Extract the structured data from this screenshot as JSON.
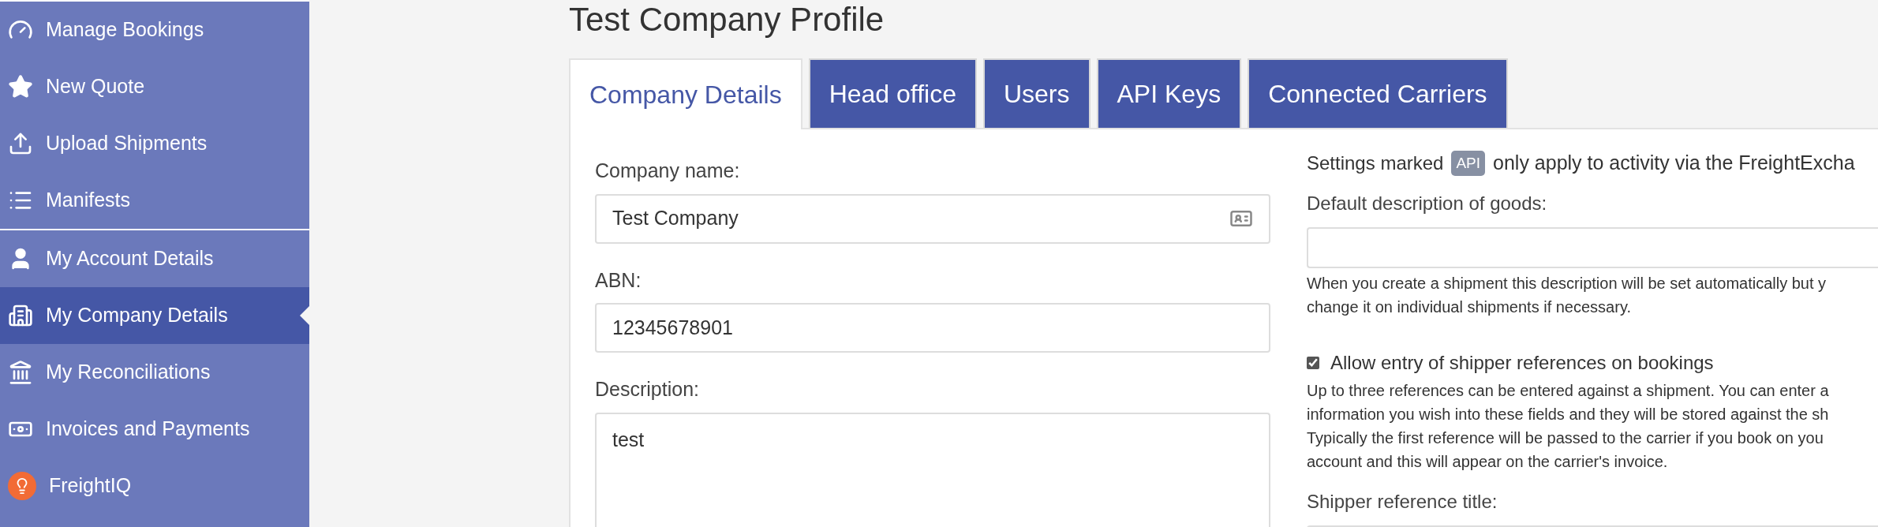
{
  "sidebar": {
    "groups": [
      {
        "items": [
          {
            "label": "Manage Bookings",
            "selected": false
          },
          {
            "label": "New Quote",
            "selected": false
          },
          {
            "label": "Upload Shipments",
            "selected": false
          },
          {
            "label": "Manifests",
            "selected": false
          }
        ]
      },
      {
        "items": [
          {
            "label": "My Account Details",
            "selected": false
          },
          {
            "label": "My Company Details",
            "selected": true
          },
          {
            "label": "My Reconciliations",
            "selected": false
          },
          {
            "label": "Invoices and Payments",
            "selected": false
          },
          {
            "label": "FreightIQ",
            "selected": false
          }
        ]
      }
    ]
  },
  "page_title": "Test Company Profile",
  "tabs": [
    {
      "label": "Company Details",
      "selected": true
    },
    {
      "label": "Head office",
      "selected": false
    },
    {
      "label": "Users",
      "selected": false
    },
    {
      "label": "API Keys",
      "selected": false
    },
    {
      "label": "Connected Carriers",
      "selected": false
    }
  ],
  "left_form": {
    "company_name": {
      "label": "Company name:",
      "value": "Test Company"
    },
    "abn": {
      "label": "ABN:",
      "value": "12345678901"
    },
    "description": {
      "label": "Description:",
      "value": "test"
    }
  },
  "right_form": {
    "notice": {
      "before": "Settings marked",
      "badge": "API",
      "after": "only apply to activity via the FreightExcha"
    },
    "default_description": {
      "label": "Default description of goods:",
      "help_lines": [
        "When you create a shipment this description will be set automatically but y",
        "change it on individual shipments if necessary."
      ]
    },
    "shipper_references": {
      "label": "Allow entry of shipper references on bookings",
      "checked": true,
      "help_lines": [
        "Up to three references can be entered against a shipment. You can enter a",
        "information you wish into these fields and they will be stored against the sh",
        "Typically the first reference will be passed to the carrier if you book on you",
        "account and this will appear on the carrier's invoice."
      ]
    },
    "shipper_reference_title": {
      "label": "Shipper reference title:"
    }
  }
}
